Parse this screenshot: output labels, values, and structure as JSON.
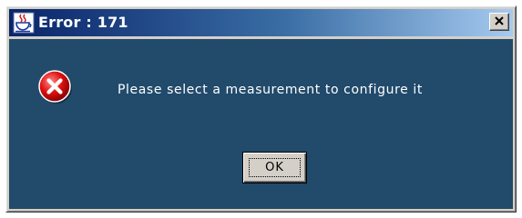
{
  "window": {
    "title": "Error : 171",
    "app_icon": "java-cup-icon",
    "close_icon": "close-icon"
  },
  "dialog": {
    "icon": "error-icon",
    "message": "Please select a measurement to configure it",
    "ok_label": "OK"
  },
  "colors": {
    "titlebar_start": "#0a246a",
    "titlebar_end": "#a6caf0",
    "content_background": "#214a6b",
    "button_face": "#d4d0c8",
    "error_red": "#e01010"
  }
}
